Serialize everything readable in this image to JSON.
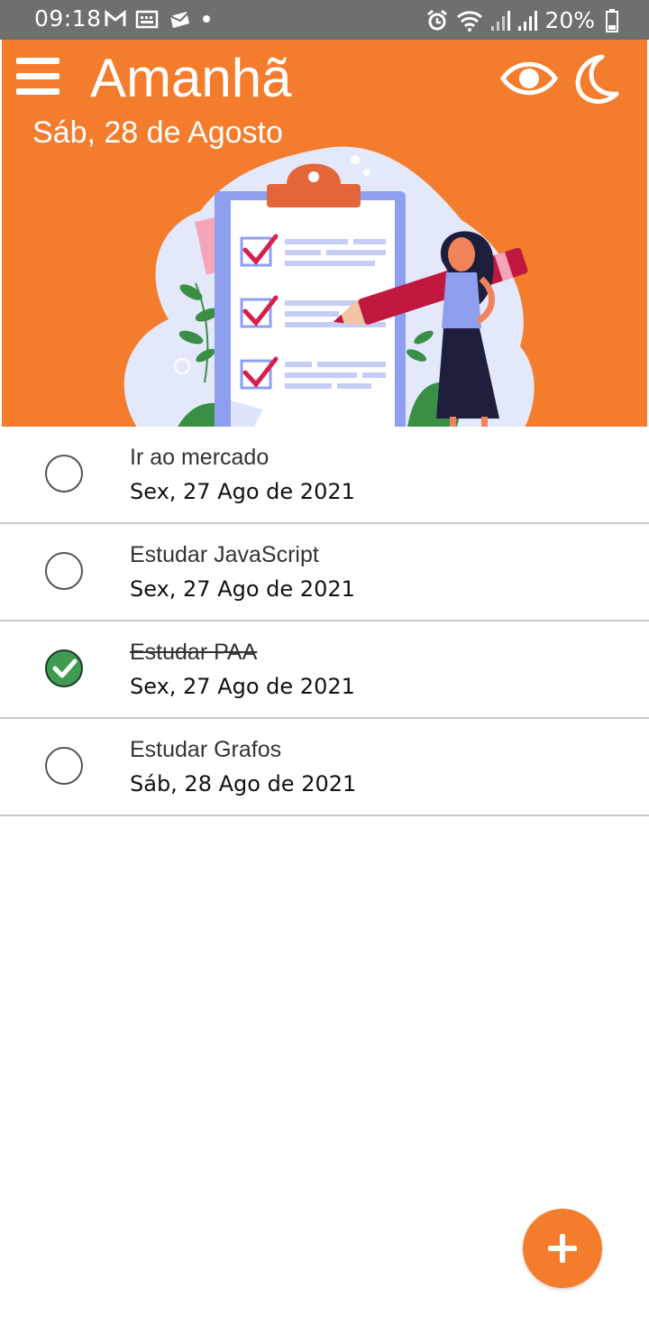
{
  "status_bar": {
    "time": "09:18",
    "battery": "20%",
    "left_icons": [
      "gmail-icon",
      "calendar-icon",
      "mail-icon",
      "dot-icon"
    ],
    "right_icons": [
      "alarm-icon",
      "wifi-icon",
      "signal-icon",
      "signal-icon",
      "battery-icon"
    ]
  },
  "header": {
    "title": "Amanhã",
    "date": "Sáb, 28 de Agosto",
    "background": "#f47d2d",
    "icons": [
      "menu-icon",
      "eye-icon",
      "moon-icon"
    ]
  },
  "tasks": [
    {
      "title": "Ir ao mercado",
      "date": "Sex, 27 Ago de 2021",
      "done": false
    },
    {
      "title": "Estudar JavaScript",
      "date": "Sex, 27 Ago de 2021",
      "done": false
    },
    {
      "title": "Estudar PAA",
      "date": "Sex, 27 Ago de 2021",
      "done": true
    },
    {
      "title": "Estudar Grafos",
      "date": "Sáb, 28 Ago de 2021",
      "done": false
    }
  ],
  "colors": {
    "accent": "#f47d2d",
    "done_green": "#3f9b4f"
  },
  "fab": {
    "icon": "plus-icon"
  }
}
